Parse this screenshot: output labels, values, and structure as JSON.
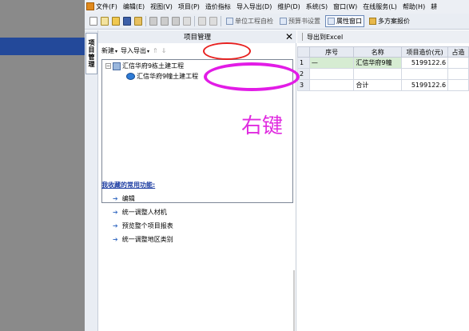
{
  "menubar": {
    "items": [
      "文件(F)",
      "编辑(E)",
      "视图(V)",
      "项目(P)",
      "造价指标",
      "导入导出(D)",
      "维护(D)",
      "系统(S)",
      "窗口(W)",
      "在线服务(L)",
      "帮助(H)",
      "耕"
    ]
  },
  "toolbar": {
    "unit_check": "单位工程自检",
    "report_settings": "预算书设置",
    "properties_window": "属性窗口",
    "multi_report": "多方案报价"
  },
  "vtab": {
    "label": "项目管理"
  },
  "panel": {
    "title": "项目管理",
    "close": "✕",
    "new_label": "新建",
    "import_export_label": "导入导出",
    "dropdown_arrow": "▾",
    "up_arrow": "⇑",
    "down_arrow": "⇓",
    "tree": {
      "root_expander": "−",
      "root_label": "汇信华府9栋土建工程",
      "child_label": "汇信华府9幢土建工程"
    },
    "favorites": {
      "title": "我收藏的常用功能:",
      "items": [
        "编辑",
        "统一调整人材机",
        "预览整个项目报表",
        "统一调整地区类别"
      ]
    }
  },
  "right": {
    "export_excel": "导出到Excel",
    "table": {
      "headers": [
        "序号",
        "名称",
        "项目造价(元)",
        "占造"
      ],
      "rows": [
        {
          "no": "1",
          "seq": "—",
          "name": "汇信华府9幢",
          "cost": "5199122.6",
          "pct": ""
        },
        {
          "no": "2",
          "seq": "",
          "name": "",
          "cost": "",
          "pct": ""
        },
        {
          "no": "3",
          "seq": "",
          "name": "合计",
          "cost": "5199122.6",
          "pct": ""
        }
      ]
    }
  },
  "annotation": {
    "text": "右键"
  }
}
